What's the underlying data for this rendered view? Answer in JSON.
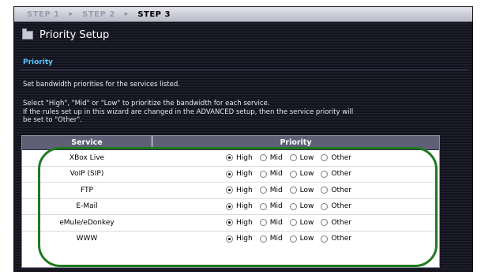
{
  "steps": [
    {
      "label": "STEP 1",
      "active": false
    },
    {
      "label": "STEP 2",
      "active": false
    },
    {
      "label": "STEP 3",
      "active": true
    }
  ],
  "step_separator": "▸",
  "title": "Priority Setup",
  "section_heading": "Priority",
  "description": "Set bandwidth priorities for the services listed.",
  "instructions": [
    "Select \"High\", \"Mid\" or \"Low\" to prioritize the bandwidth for each service.",
    "If the rules set up in this wizard are changed in the ADVANCED setup, then the service priority will",
    "be set to \"Other\"."
  ],
  "table": {
    "headers": {
      "service": "Service",
      "priority": "Priority"
    },
    "option_labels": [
      "High",
      "Mid",
      "Low",
      "Other"
    ],
    "rows": [
      {
        "service": "XBox Live",
        "selected": "High"
      },
      {
        "service": "VoIP (SIP)",
        "selected": "High"
      },
      {
        "service": "FTP",
        "selected": "High"
      },
      {
        "service": "E-Mail",
        "selected": "High"
      },
      {
        "service": "eMule/eDonkey",
        "selected": "High"
      },
      {
        "service": "WWW",
        "selected": "High"
      }
    ]
  },
  "colors": {
    "background": "#1d1d2b",
    "heading_accent": "#4fc8ff",
    "table_header": "#5f5f76",
    "highlight_oval": "#1f7a1f"
  }
}
